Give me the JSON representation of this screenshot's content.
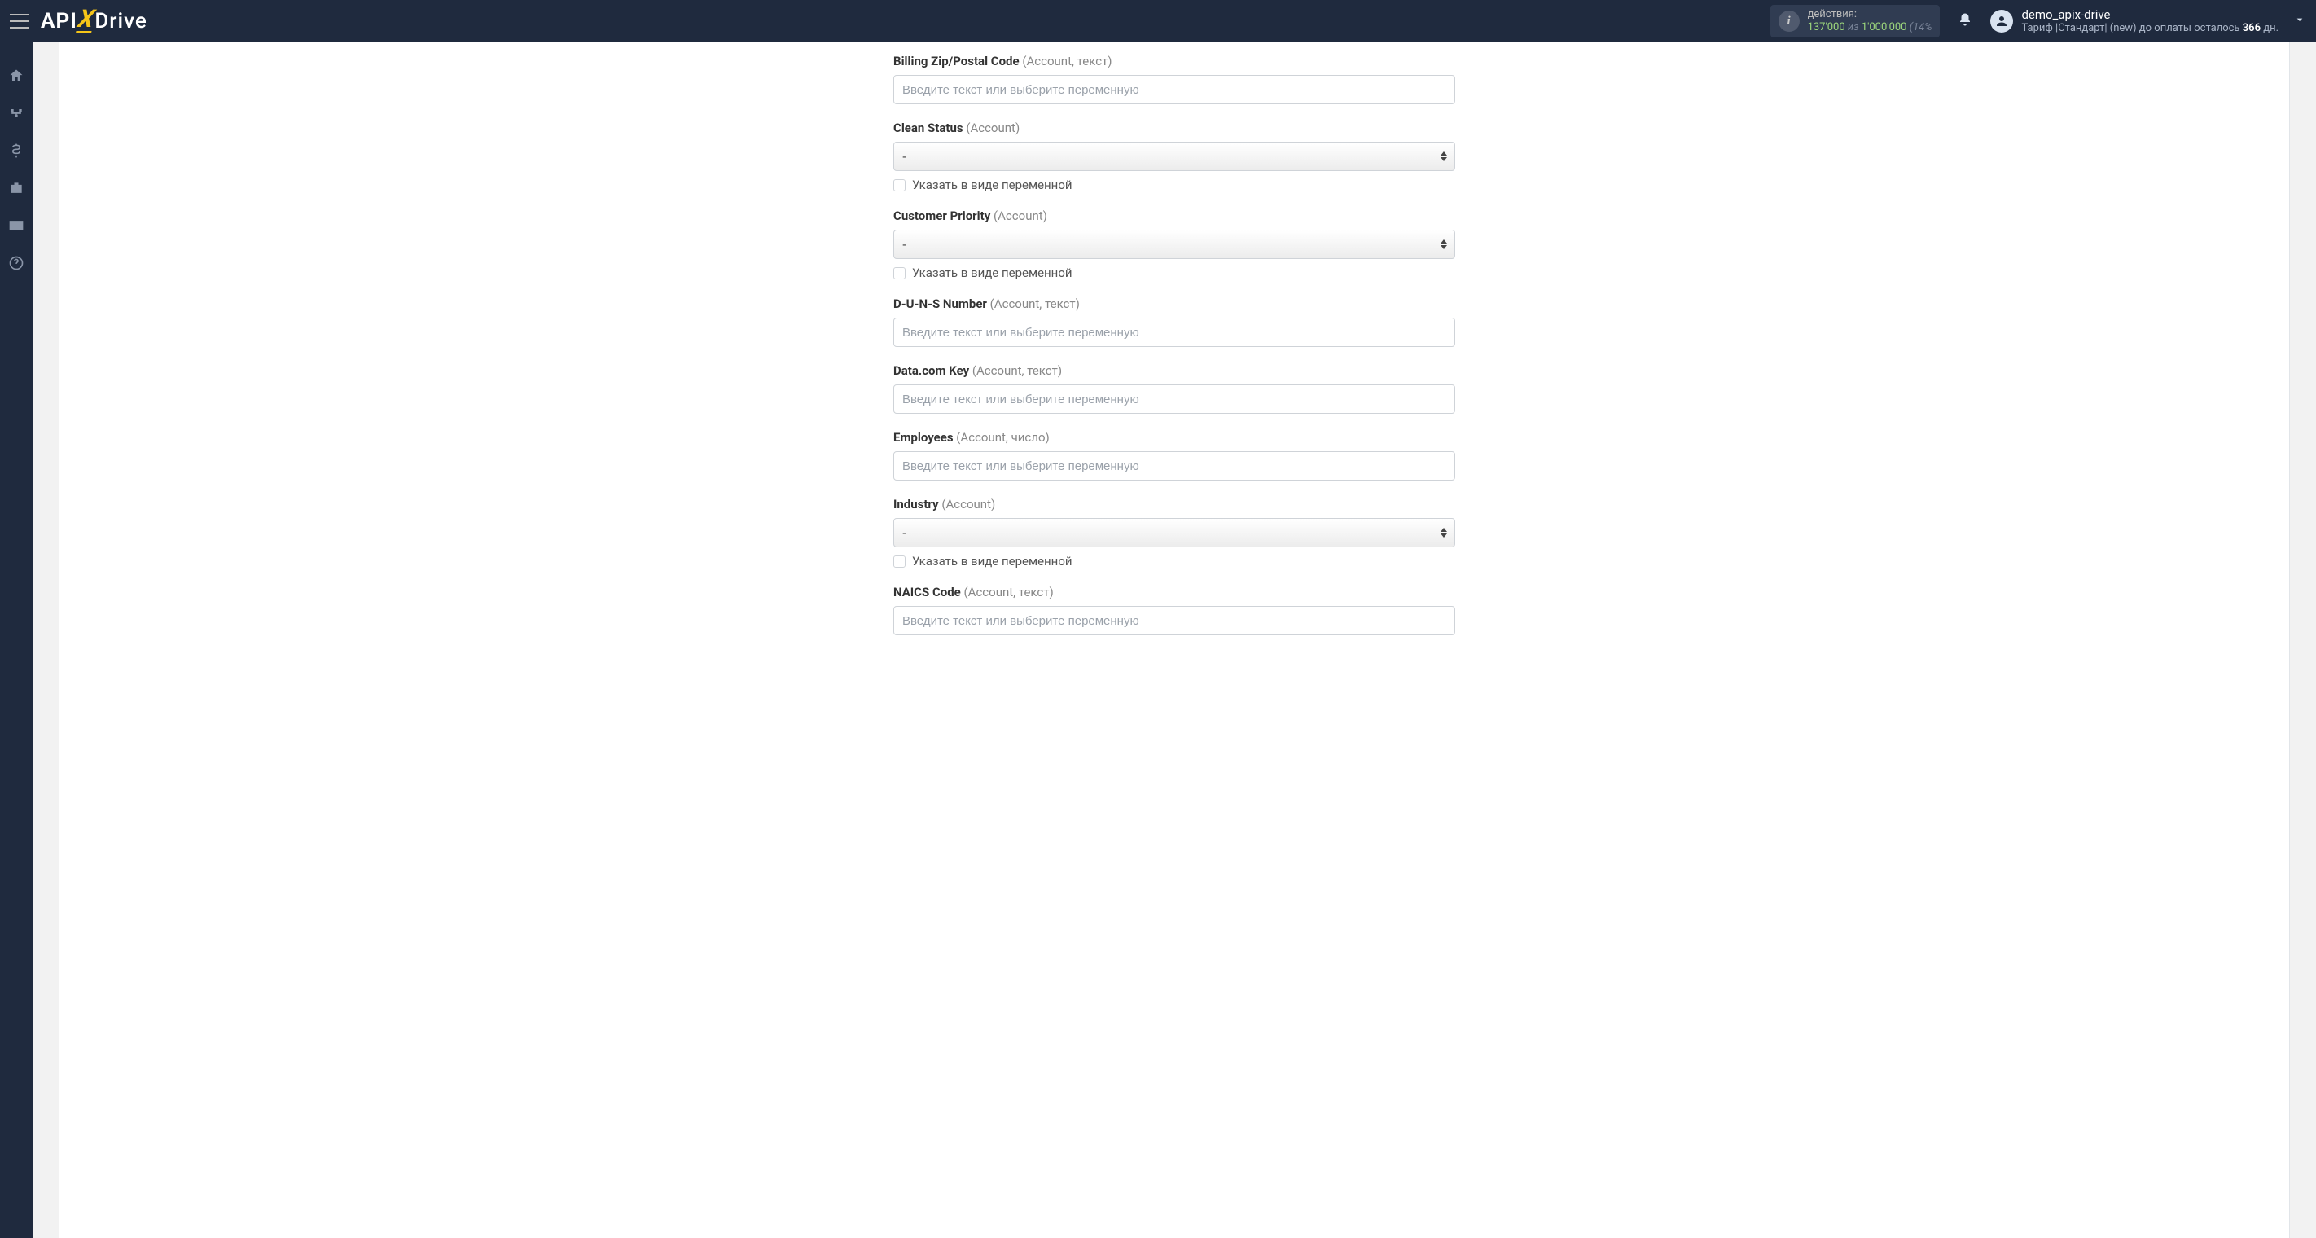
{
  "header": {
    "logo_api": "API",
    "logo_x": "X",
    "logo_drive": "Drive",
    "actions_label": "действия:",
    "actions_used": "137'000",
    "actions_sep": "из",
    "actions_total": "1'000'000",
    "actions_pct": "(14%",
    "username": "demo_apix-drive",
    "tariff_prefix": "Тариф |Стандарт| (new) до оплаты осталось ",
    "tariff_days": "366",
    "tariff_suffix": " дн."
  },
  "form": {
    "placeholder_text": "Введите текст или выберите переменную",
    "select_dash": "-",
    "checkbox_label": "Указать в виде переменной",
    "fields": {
      "billing_zip": {
        "label": "Billing Zip/Postal Code",
        "hint": "(Account, текст)"
      },
      "clean_status": {
        "label": "Clean Status",
        "hint": "(Account)"
      },
      "customer_priority": {
        "label": "Customer Priority",
        "hint": "(Account)"
      },
      "duns": {
        "label": "D-U-N-S Number",
        "hint": "(Account, текст)"
      },
      "datacom": {
        "label": "Data.com Key",
        "hint": "(Account, текст)"
      },
      "employees": {
        "label": "Employees",
        "hint": "(Account, число)"
      },
      "industry": {
        "label": "Industry",
        "hint": "(Account)"
      },
      "naics": {
        "label": "NAICS Code",
        "hint": "(Account, текст)"
      }
    }
  }
}
